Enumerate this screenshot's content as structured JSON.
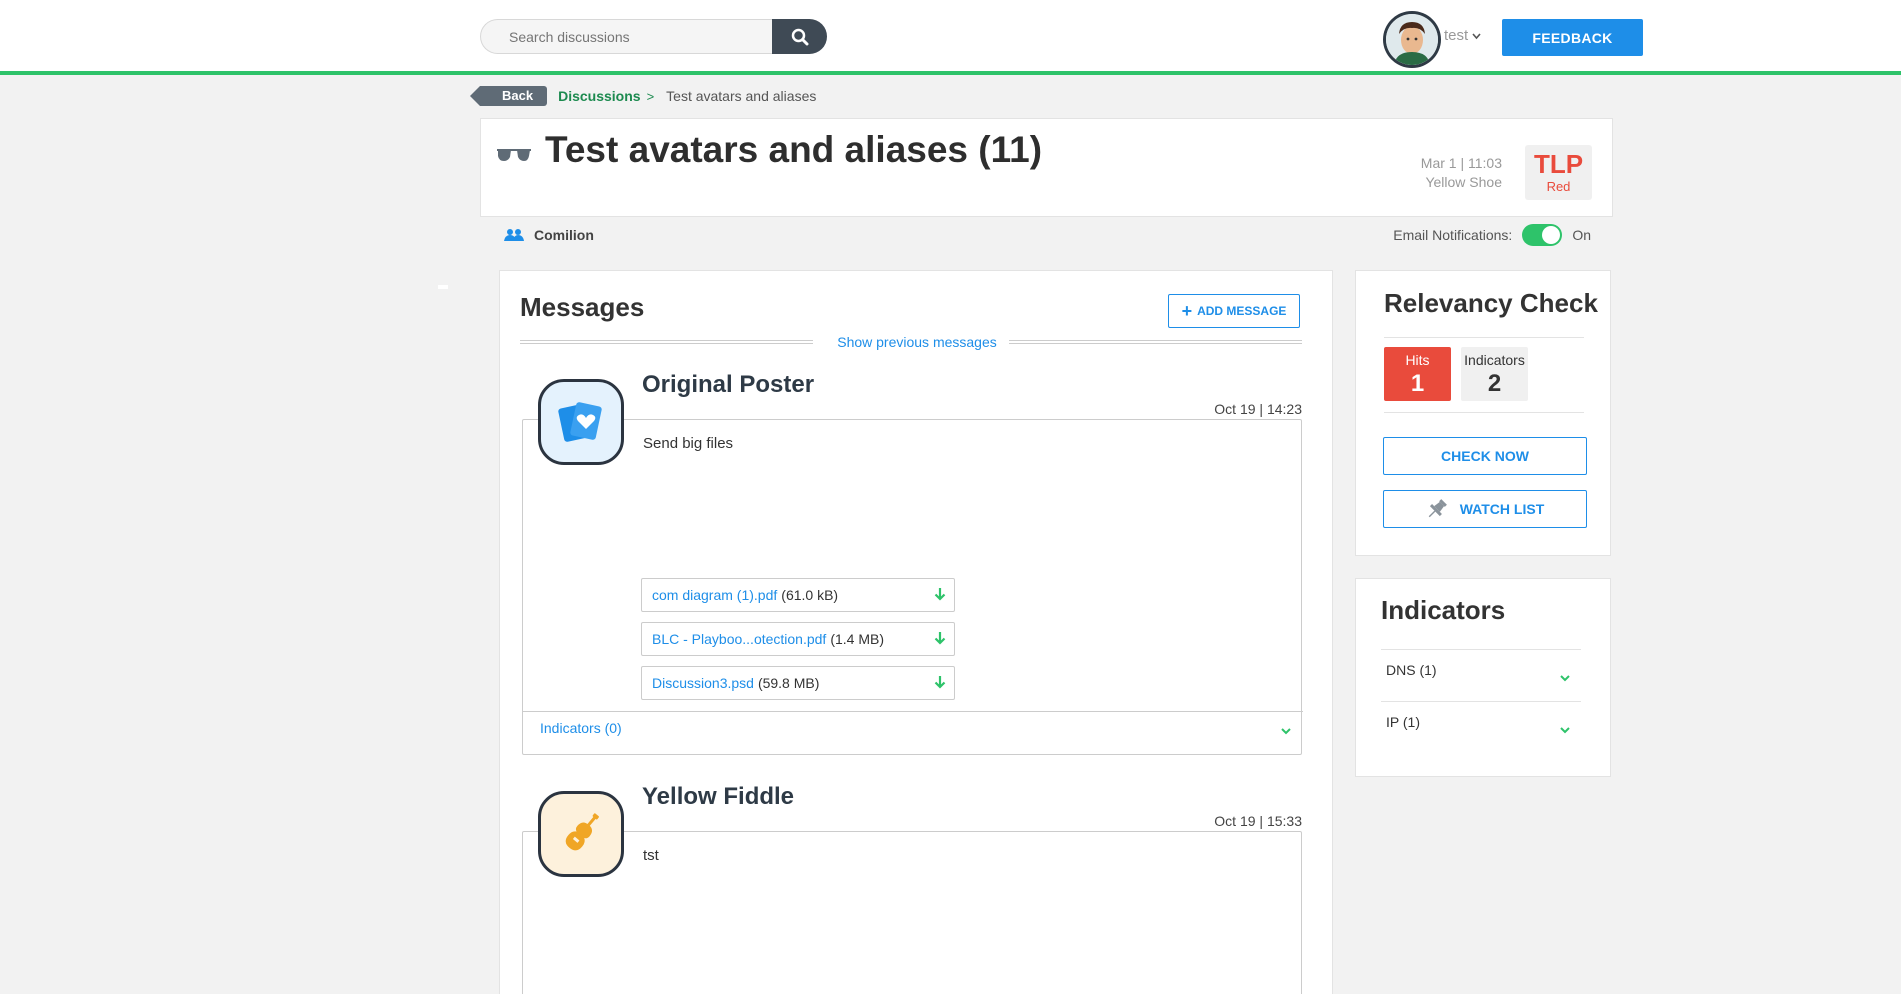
{
  "header": {
    "search_placeholder": "Search discussions",
    "user_name": "test",
    "feedback_label": "FEEDBACK"
  },
  "breadcrumb": {
    "back_label": "Back",
    "discussions_label": "Discussions",
    "separator": ">",
    "current": "Test avatars and aliases"
  },
  "discussion": {
    "title": "Test avatars and aliases (11)",
    "date": "Mar 1 | 11:03",
    "author": "Yellow Shoe",
    "tlp_label": "TLP",
    "tlp_level": "Red",
    "organization": "Comilion",
    "email_notifications_label": "Email Notifications:",
    "email_notifications_state": "On"
  },
  "messages": {
    "title": "Messages",
    "add_label": "ADD MESSAGE",
    "show_previous": "Show previous messages",
    "items": [
      {
        "author": "Original Poster",
        "date": "Oct 19 | 14:23",
        "body": "Send big files",
        "attachments": [
          {
            "name": "com diagram (1).pdf",
            "size": "(61.0 kB)"
          },
          {
            "name": "BLC - Playboo...otection.pdf",
            "size": "(1.4 MB)"
          },
          {
            "name": "Discussion3.psd",
            "size": "(59.8 MB)"
          }
        ],
        "indicators_label": "Indicators (0)"
      },
      {
        "author": "Yellow Fiddle",
        "date": "Oct 19 | 15:33",
        "body": "tst"
      }
    ]
  },
  "relevancy": {
    "title": "Relevancy Check",
    "hits_label": "Hits",
    "hits_value": "1",
    "indicators_label": "Indicators",
    "indicators_value": "2",
    "check_now_label": "CHECK NOW",
    "watch_list_label": "WATCH LIST"
  },
  "indicators_panel": {
    "title": "Indicators",
    "items": [
      {
        "label": "DNS (1)"
      },
      {
        "label": "IP (1)"
      }
    ]
  },
  "colors": {
    "accent_green": "#2ec36a",
    "accent_blue": "#1e8ee8",
    "tlp_red": "#e94b3c"
  }
}
